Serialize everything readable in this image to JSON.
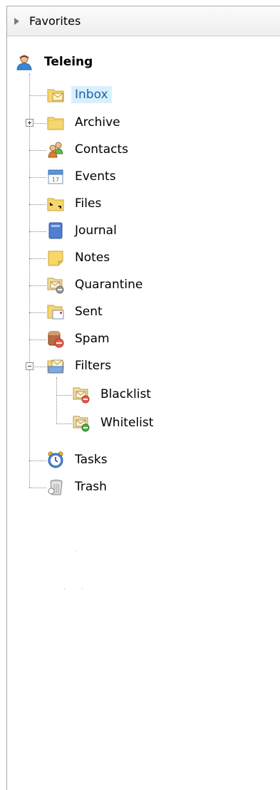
{
  "favorites": {
    "label": "Favorites"
  },
  "account": {
    "label": "Teleing",
    "icon": "user-icon"
  },
  "folders": [
    {
      "label": "Inbox",
      "icon": "inbox-folder-icon",
      "selected": true
    },
    {
      "label": "Archive",
      "icon": "folder-icon",
      "expandable": true
    },
    {
      "label": "Contacts",
      "icon": "contacts-icon"
    },
    {
      "label": "Events",
      "icon": "calendar-icon"
    },
    {
      "label": "Files",
      "icon": "files-folder-icon"
    },
    {
      "label": "Journal",
      "icon": "journal-icon"
    },
    {
      "label": "Notes",
      "icon": "notes-icon"
    },
    {
      "label": "Quarantine",
      "icon": "quarantine-icon"
    },
    {
      "label": "Sent",
      "icon": "sent-folder-icon"
    },
    {
      "label": "Spam",
      "icon": "spam-icon"
    },
    {
      "label": "Filters",
      "icon": "filters-icon",
      "expanded": true,
      "children": [
        {
          "label": "Blacklist",
          "icon": "blacklist-icon"
        },
        {
          "label": "Whitelist",
          "icon": "whitelist-icon"
        }
      ]
    },
    {
      "label": "Tasks",
      "icon": "tasks-clock-icon"
    },
    {
      "label": "Trash",
      "icon": "trash-icon"
    }
  ],
  "colors": {
    "selection_bg": "#d8f0fb",
    "selection_text": "#1b62a8",
    "folder_yellow": "#f5d76e"
  }
}
